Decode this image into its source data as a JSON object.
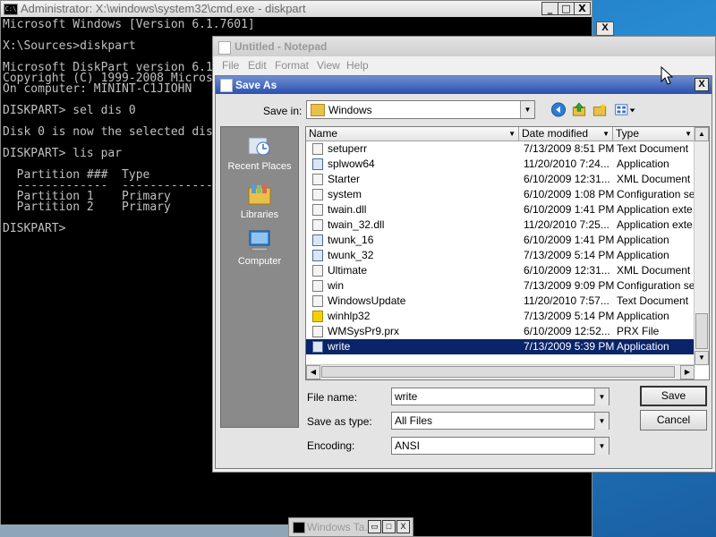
{
  "cmd": {
    "title": "Administrator: X:\\windows\\system32\\cmd.exe - diskpart",
    "icon_text": "C:\\",
    "lines": [
      "Microsoft Windows [Version 6.1.7601]",
      "",
      "X:\\Sources>diskpart",
      "",
      "Microsoft DiskPart version 6.1",
      "Copyright (C) 1999-2008 Micros",
      "On computer: MININT-C1JIOHN",
      "",
      "DISKPART> sel dis 0",
      "",
      "Disk 0 is now the selected dis",
      "",
      "DISKPART> lis par",
      "",
      "  Partition ###  Type",
      "  -------------  ----------------",
      "  Partition 1    Primary",
      "  Partition 2    Primary",
      "",
      "DISKPART>"
    ],
    "minimize": "_",
    "maximize": "□",
    "close": "X"
  },
  "notepad": {
    "title": "Untitled - Notepad",
    "menu": [
      "File",
      "Edit",
      "Format",
      "View",
      "Help"
    ]
  },
  "dialog": {
    "title": "Save As",
    "close": "X",
    "save_in_label": "Save in:",
    "save_in_value": "Windows",
    "places": [
      {
        "label": "Recent Places",
        "icon": "recent-places-icon"
      },
      {
        "label": "Libraries",
        "icon": "libraries-icon"
      },
      {
        "label": "Computer",
        "icon": "computer-icon"
      }
    ],
    "columns": [
      "Name",
      "Date modified",
      "Type"
    ],
    "files": [
      {
        "name": "setuperr",
        "date": "7/13/2009 8:51 PM",
        "type": "Text Document",
        "icon": "text-file-icon"
      },
      {
        "name": "splwow64",
        "date": "11/20/2010 7:24...",
        "type": "Application",
        "icon": "application-icon"
      },
      {
        "name": "Starter",
        "date": "6/10/2009 12:31...",
        "type": "XML Document",
        "icon": "xml-file-icon"
      },
      {
        "name": "system",
        "date": "6/10/2009 1:08 PM",
        "type": "Configuration se...",
        "icon": "config-file-icon"
      },
      {
        "name": "twain.dll",
        "date": "6/10/2009 1:41 PM",
        "type": "Application exte...",
        "icon": "dll-file-icon"
      },
      {
        "name": "twain_32.dll",
        "date": "11/20/2010 7:25...",
        "type": "Application exte...",
        "icon": "dll-file-icon"
      },
      {
        "name": "twunk_16",
        "date": "6/10/2009 1:41 PM",
        "type": "Application",
        "icon": "application-icon"
      },
      {
        "name": "twunk_32",
        "date": "7/13/2009 5:14 PM",
        "type": "Application",
        "icon": "application-icon"
      },
      {
        "name": "Ultimate",
        "date": "6/10/2009 12:31...",
        "type": "XML Document",
        "icon": "xml-file-icon"
      },
      {
        "name": "win",
        "date": "7/13/2009 9:09 PM",
        "type": "Configuration se...",
        "icon": "config-file-icon"
      },
      {
        "name": "WindowsUpdate",
        "date": "11/20/2010 7:57...",
        "type": "Text Document",
        "icon": "text-file-icon"
      },
      {
        "name": "winhlp32",
        "date": "7/13/2009 5:14 PM",
        "type": "Application",
        "icon": "help-icon"
      },
      {
        "name": "WMSysPr9.prx",
        "date": "6/10/2009 12:52...",
        "type": "PRX File",
        "icon": "prx-file-icon"
      },
      {
        "name": "write",
        "date": "7/13/2009 5:39 PM",
        "type": "Application",
        "icon": "write-app-icon"
      }
    ],
    "selected_index": 13,
    "file_name_label": "File name:",
    "file_name_value": "write",
    "save_as_type_label": "Save as type:",
    "save_as_type_value": "All Files",
    "encoding_label": "Encoding:",
    "encoding_value": "ANSI",
    "save_button": "Save",
    "cancel_button": "Cancel"
  },
  "taskbar": {
    "item": "Windows Ta..."
  },
  "colors": {
    "selection": "#0a246a",
    "dialog_title": "#2b4fb0",
    "console_bg": "#000000",
    "console_text": "#c0c0c0"
  }
}
